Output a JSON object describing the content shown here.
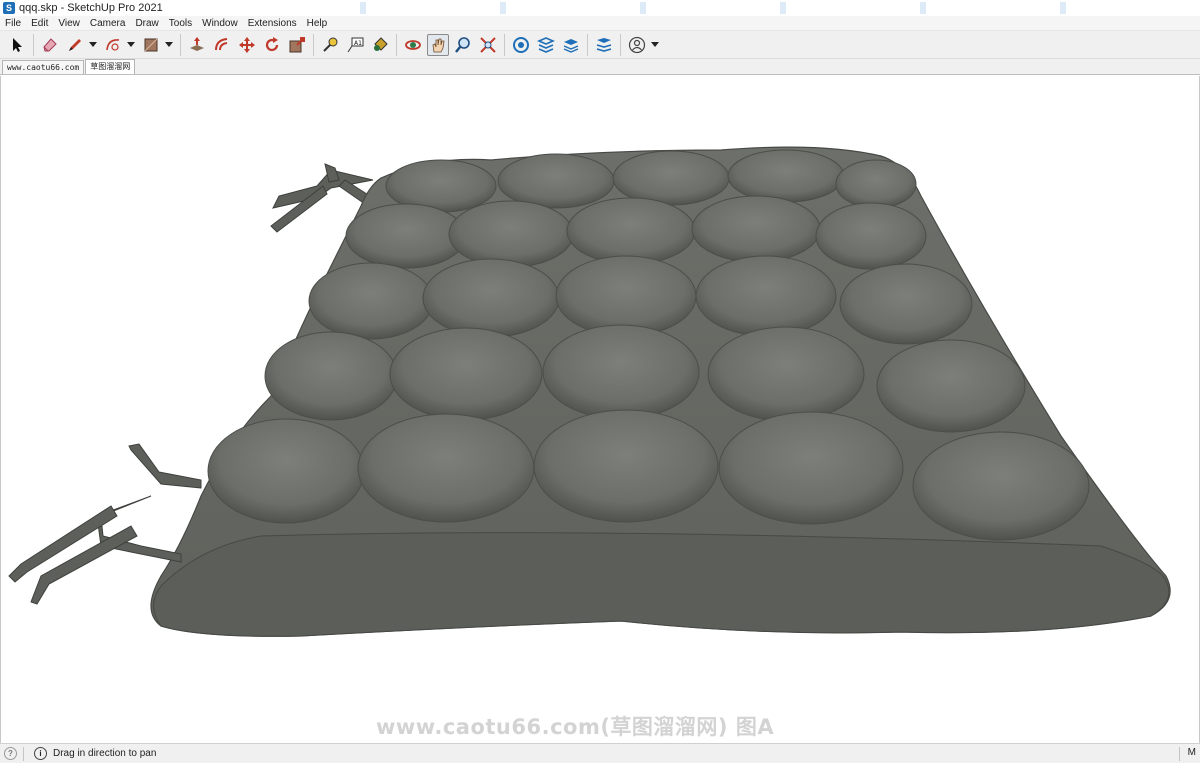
{
  "window": {
    "title": "qqq.skp - SketchUp Pro 2021"
  },
  "menu": {
    "items": [
      "File",
      "Edit",
      "View",
      "Camera",
      "Draw",
      "Tools",
      "Window",
      "Extensions",
      "Help"
    ]
  },
  "toolbar": {
    "tools": [
      {
        "icon": "select-arrow-icon"
      },
      {
        "icon": "eraser-icon"
      },
      {
        "icon": "pencil-line-icon"
      },
      {
        "icon": "arc-icon"
      },
      {
        "icon": "rectangle-shape-icon"
      },
      {
        "icon": "push-pull-icon"
      },
      {
        "icon": "offset-icon"
      },
      {
        "icon": "move-icon"
      },
      {
        "icon": "rotate-icon"
      },
      {
        "icon": "scale-icon"
      },
      {
        "icon": "tape-measure-icon"
      },
      {
        "icon": "text-label-icon"
      },
      {
        "icon": "paint-bucket-icon"
      },
      {
        "icon": "orbit-icon"
      },
      {
        "icon": "pan-hand-icon",
        "active": true
      },
      {
        "icon": "zoom-icon"
      },
      {
        "icon": "zoom-extents-icon"
      },
      {
        "icon": "3d-warehouse-icon"
      },
      {
        "icon": "extension-warehouse-icon"
      },
      {
        "icon": "layout-icon"
      },
      {
        "icon": "extension-manager-icon"
      },
      {
        "icon": "account-user-icon"
      }
    ]
  },
  "tabs": [
    {
      "label": "www.caotu66.com",
      "active": false
    },
    {
      "label": "草图溜溜网",
      "active": true
    }
  ],
  "viewport": {
    "model": "seat-cushion",
    "cushion_color": "#6f716c",
    "watermark": "www.caotu66.com(草图溜溜网) 图A"
  },
  "status": {
    "message": "Drag in direction to pan",
    "right_label": "M"
  }
}
